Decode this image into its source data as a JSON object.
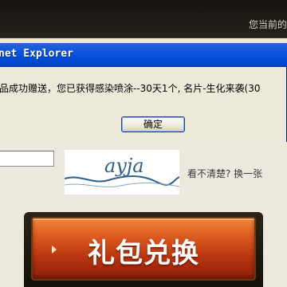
{
  "header": {
    "user_text": "您当前的"
  },
  "dialog": {
    "title": "net Explorer",
    "message": "品成功赠送，您已获得感染喷涂--30天1个, 名片-生化来袭(30",
    "ok_label": "确定"
  },
  "captcha": {
    "input_value": "",
    "image_text": "ayja",
    "refresh_label": "看不清楚? 换一张"
  },
  "redeem": {
    "label": "礼包兑换"
  },
  "colors": {
    "dialog_titlebar": "#0a55e0",
    "button_orange": "#dc5a1e",
    "captcha_ink": "#2e5f86"
  }
}
